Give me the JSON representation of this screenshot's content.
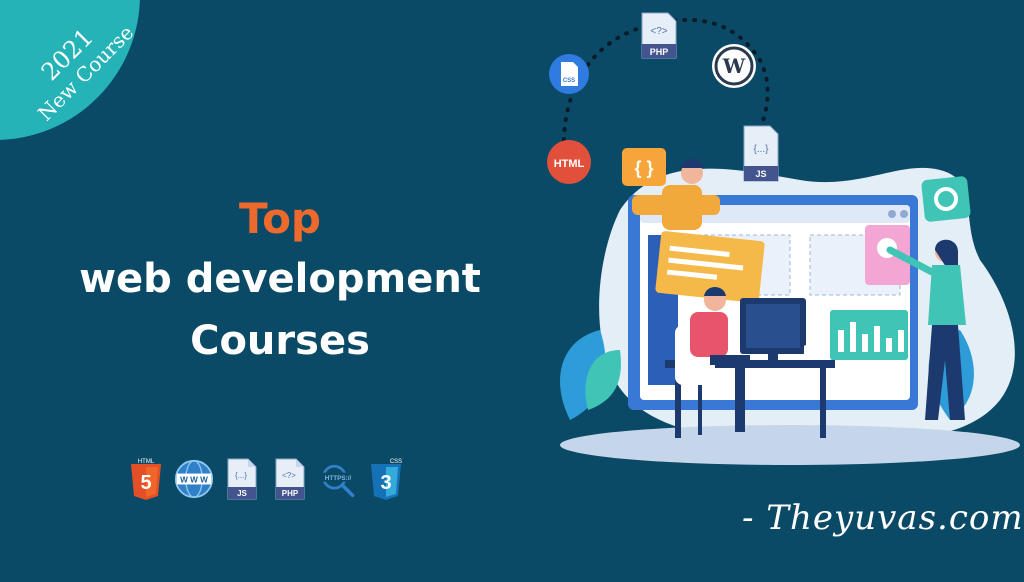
{
  "badge": {
    "year": "2021",
    "label": "New Course"
  },
  "headline": {
    "top": "Top",
    "line1": "web development",
    "line2": "Courses"
  },
  "tech_icons": [
    "html5-icon",
    "www-icon",
    "js-file-icon",
    "php-file-icon",
    "https-icon",
    "css3-icon"
  ],
  "tech_labels": {
    "html": "HTML",
    "www": "W W W",
    "js_code": "{...}",
    "js": "JS",
    "php_code": "<?>",
    "php": "PHP",
    "https": "HTTPS://",
    "css": "CSS"
  },
  "orbit_labels": {
    "html": "HTML",
    "css": "CSS",
    "php_code": "<?>",
    "php": "PHP",
    "js_code": "{...}",
    "js": "JS",
    "braces": "{ }"
  },
  "signature": "- Theyuvas.com",
  "colors": {
    "background": "#0b4a66",
    "badge": "#26b3b8",
    "accent": "#ee6a2c",
    "text": "#ffffff"
  }
}
